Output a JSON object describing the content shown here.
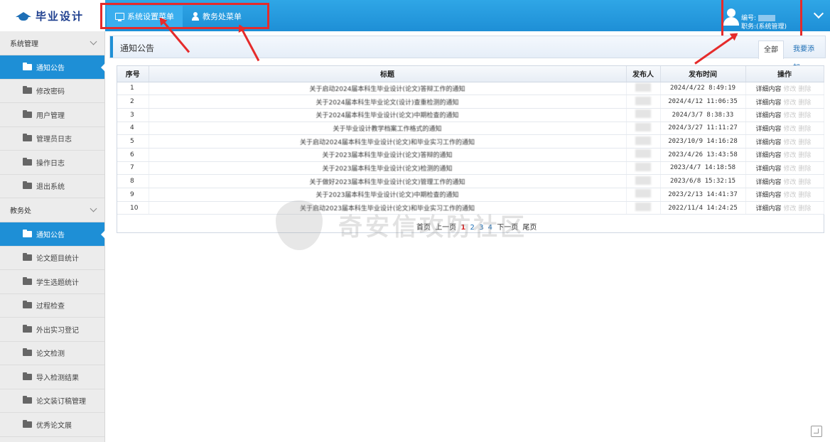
{
  "app": {
    "title": "毕业设计"
  },
  "top_menu": [
    {
      "label": "系统设置菜单",
      "icon": "monitor-icon"
    },
    {
      "label": "教务处菜单",
      "icon": "person-icon"
    }
  ],
  "user": {
    "id_label": "编号:",
    "role_label": "职务:(系统管理)"
  },
  "sidebar": {
    "groups": [
      {
        "title": "系统管理",
        "items": [
          {
            "label": "通知公告",
            "active": true
          },
          {
            "label": "修改密码"
          },
          {
            "label": "用户管理"
          },
          {
            "label": "管理员日志"
          },
          {
            "label": "操作日志"
          },
          {
            "label": "退出系统"
          }
        ]
      },
      {
        "title": "教务处",
        "items": [
          {
            "label": "通知公告",
            "active": true
          },
          {
            "label": "论文题目统计"
          },
          {
            "label": "学生选题统计"
          },
          {
            "label": "过程检查"
          },
          {
            "label": "外出实习登记"
          },
          {
            "label": "论文检测"
          },
          {
            "label": "导入检测结果"
          },
          {
            "label": "论文装订稿管理"
          },
          {
            "label": "优秀论文展"
          }
        ]
      }
    ]
  },
  "content": {
    "title": "通知公告",
    "tabs": {
      "all": "全部",
      "add": "我要添加"
    }
  },
  "table": {
    "headers": {
      "idx": "序号",
      "title": "标题",
      "publisher": "发布人",
      "time": "发布时间",
      "ops": "操作"
    },
    "ops_labels": {
      "detail": "详细内容",
      "edit": "修改",
      "delete": "删除"
    },
    "rows": [
      {
        "idx": "1",
        "title": "关于启动2024届本科生毕业设计(论文)答辩工作的通知",
        "time": "2024/4/22 8:49:19"
      },
      {
        "idx": "2",
        "title": "关于2024届本科生毕业论文(设计)查重检测的通知",
        "time": "2024/4/12 11:06:35"
      },
      {
        "idx": "3",
        "title": "关于2024届本科生毕业设计(论文)中期检查的通知",
        "time": "2024/3/7 8:38:33"
      },
      {
        "idx": "4",
        "title": "关于毕业设计教学档案工作格式的通知",
        "time": "2024/3/27 11:11:27"
      },
      {
        "idx": "5",
        "title": "关于启动2024届本科生毕业设计(论文)和毕业实习工作的通知",
        "time": "2023/10/9 14:16:28"
      },
      {
        "idx": "6",
        "title": "关于2023届本科生毕业设计(论文)答辩的通知",
        "time": "2023/4/26 13:43:58"
      },
      {
        "idx": "7",
        "title": "关于2023届本科生毕业设计(论文)检测的通知",
        "time": "2023/4/7 14:18:58"
      },
      {
        "idx": "8",
        "title": "关于做好2023届本科生毕业设计(论文)管理工作的通知",
        "time": "2023/6/8 15:32:15"
      },
      {
        "idx": "9",
        "title": "关于2023届本科生毕业设计(论文)中期检查的通知",
        "time": "2023/2/13 14:41:37"
      },
      {
        "idx": "10",
        "title": "关于启动2023届本科生毕业设计(论文)和毕业实习工作的通知",
        "time": "2022/11/4 14:24:25"
      }
    ]
  },
  "pager": {
    "first": "首页",
    "prev": "上一页",
    "pages": [
      "1",
      "2",
      "3",
      "4"
    ],
    "next": "下一页",
    "last": "尾页"
  },
  "watermark": {
    "text": "奇安信攻防社区"
  },
  "colors": {
    "accent": "#1e8fd6",
    "highlight": "#e52b2b"
  }
}
